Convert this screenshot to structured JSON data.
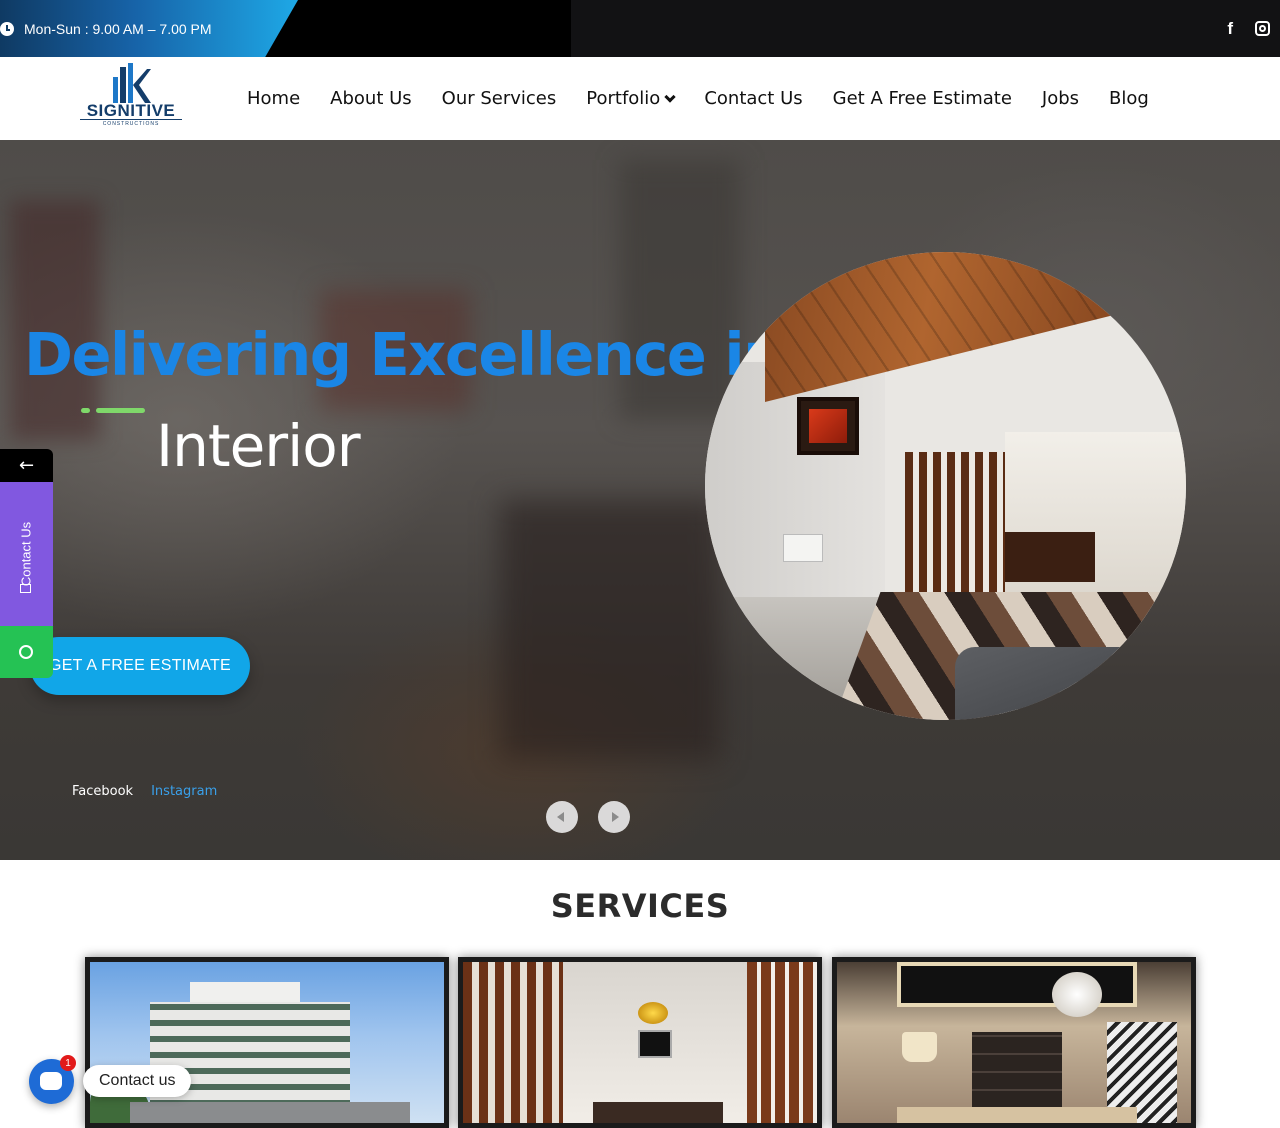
{
  "topbar": {
    "hours": "Mon-Sun : 9.00 AM – 7.00 PM",
    "social_icons": [
      "facebook-icon",
      "instagram-icon"
    ]
  },
  "brand": {
    "name": "SIGNITIVE",
    "tagline": "CONSTRUCTIONS",
    "color": "#143d6a"
  },
  "nav": {
    "items": [
      "Home",
      "About Us",
      "Our Services",
      "Portfolio",
      "Contact Us",
      "Get A Free Estimate",
      "Jobs",
      "Blog"
    ]
  },
  "hero": {
    "headline": "Delivering Excellence in",
    "rotating_word": "Interior",
    "cta": "GET A FREE ESTIMATE",
    "social_links": [
      "Facebook",
      "Instagram"
    ],
    "colors": {
      "headline": "#1a86e6",
      "cta": "#11a6e8",
      "accent": "#7fd86a"
    }
  },
  "sidebar": {
    "arrow": "←",
    "contact_label": "Contact Us",
    "contact_color": "#8158e0",
    "whatsapp_color": "#25c254"
  },
  "services": {
    "title": "SERVICES"
  },
  "chat": {
    "label": "Contact us",
    "badge": "1"
  }
}
